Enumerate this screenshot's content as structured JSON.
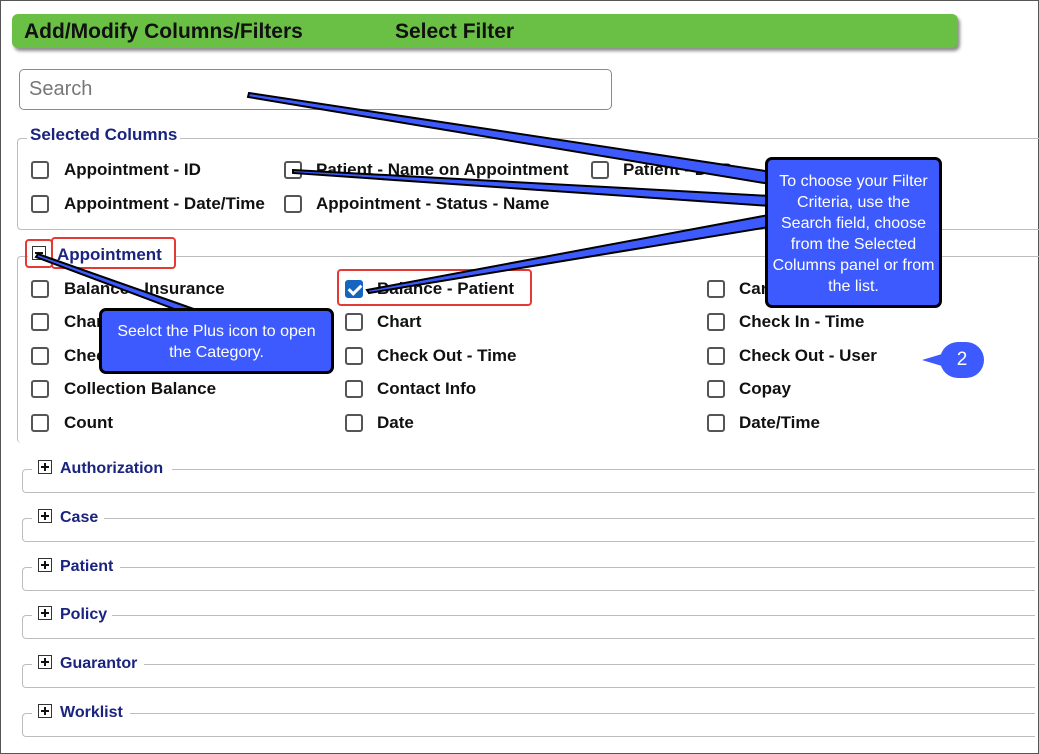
{
  "header": {
    "title": "Add/Modify Columns/Filters",
    "subtitle": "Select Filter"
  },
  "search": {
    "placeholder": "Search",
    "value": ""
  },
  "selected_columns": {
    "legend": "Selected Columns",
    "items": [
      {
        "label": "Appointment - ID",
        "checked": false
      },
      {
        "label": "Patient - Name on Appointment",
        "checked": false
      },
      {
        "label": "Patient - DOB",
        "checked": false
      },
      {
        "label": "Appointment - Date/Time",
        "checked": false
      },
      {
        "label": "Appointment - Status - Name",
        "checked": false
      }
    ]
  },
  "appointment": {
    "legend": "Appointment",
    "expanded": true,
    "items": [
      {
        "label": "Balance - Insurance",
        "checked": false
      },
      {
        "label": "Balance - Patient",
        "checked": true
      },
      {
        "label": "Cancel",
        "checked": false
      },
      {
        "label": "Charge",
        "checked": false
      },
      {
        "label": "Chart",
        "checked": false
      },
      {
        "label": "Check In - Time",
        "checked": false
      },
      {
        "label": "Check In - User",
        "checked": false
      },
      {
        "label": "Check Out - Time",
        "checked": false
      },
      {
        "label": "Check Out - User",
        "checked": false
      },
      {
        "label": "Collection Balance",
        "checked": false
      },
      {
        "label": "Contact Info",
        "checked": false
      },
      {
        "label": "Copay",
        "checked": false
      },
      {
        "label": "Count",
        "checked": false
      },
      {
        "label": "Date",
        "checked": false
      },
      {
        "label": "Date/Time",
        "checked": false
      }
    ]
  },
  "categories": [
    {
      "label": "Authorization",
      "expanded": false
    },
    {
      "label": "Case",
      "expanded": false
    },
    {
      "label": "Patient",
      "expanded": false
    },
    {
      "label": "Policy",
      "expanded": false
    },
    {
      "label": "Guarantor",
      "expanded": false
    },
    {
      "label": "Worklist",
      "expanded": false
    }
  ],
  "callouts": {
    "filter_criteria": "To choose your Filter Criteria, use the Search field, choose from the Selected Columns panel or from the list.",
    "plus_icon": "Seelct the Plus icon to open the Category.",
    "step_number": "2"
  },
  "colors": {
    "header_green": "#6abf45",
    "legend_navy": "#1a237e",
    "callout_blue": "#3d5afe",
    "highlight_red": "#e53935",
    "checkbox_checked": "#1565c0"
  }
}
